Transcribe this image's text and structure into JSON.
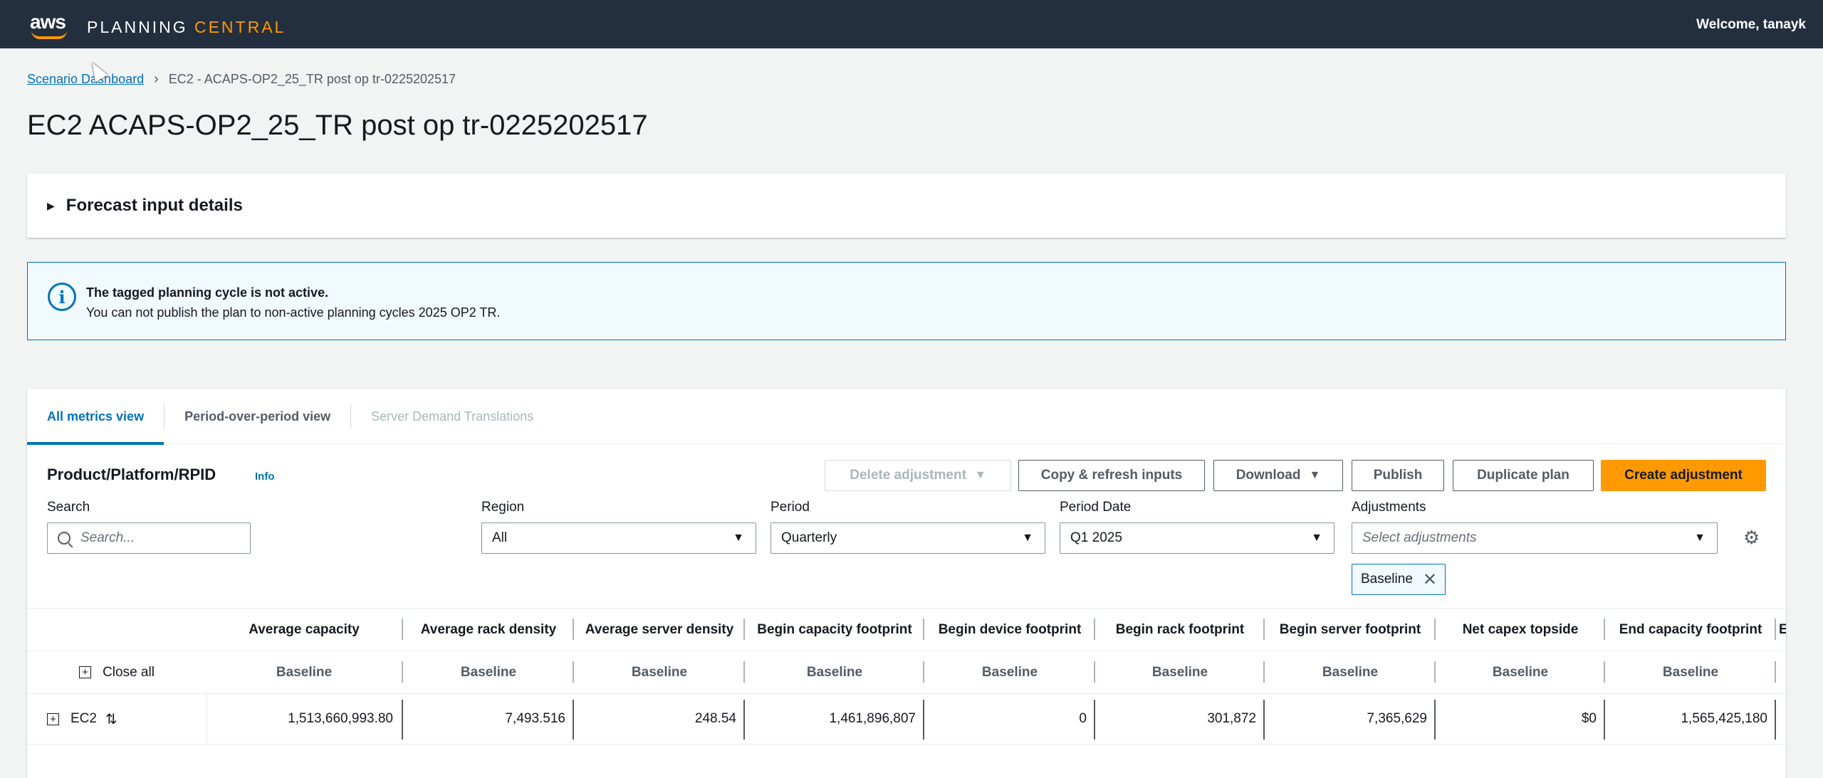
{
  "header": {
    "logo_text": "aws",
    "brand_a": "PLANNING ",
    "brand_b": "CENTRAL",
    "welcome": "Welcome, tanayk"
  },
  "breadcrumb": {
    "root": "Scenario Dashboard",
    "current": "EC2 - ACAPS-OP2_25_TR post op tr-0225202517"
  },
  "page": {
    "title": "EC2 ACAPS-OP2_25_TR post op tr-0225202517"
  },
  "forecast_panel": {
    "title": "Forecast input details"
  },
  "alert": {
    "title": "The tagged planning cycle is not active.",
    "message": "You can not publish the plan to non-active planning cycles 2025 OP2 TR."
  },
  "tabs": [
    {
      "label": "All metrics view",
      "state": "active"
    },
    {
      "label": "Period-over-period view",
      "state": "normal"
    },
    {
      "label": "Server Demand Translations",
      "state": "disabled"
    }
  ],
  "section": {
    "title": "Product/Platform/RPID",
    "info": "Info"
  },
  "actions": {
    "delete_adjustment": "Delete adjustment",
    "copy_refresh": "Copy & refresh inputs",
    "download": "Download",
    "publish": "Publish",
    "duplicate": "Duplicate plan",
    "create_adjustment": "Create adjustment"
  },
  "filters": {
    "search_label": "Search",
    "search_placeholder": "Search...",
    "region_label": "Region",
    "region_value": "All",
    "period_label": "Period",
    "period_value": "Quarterly",
    "period_date_label": "Period Date",
    "period_date_value": "Q1 2025",
    "adjustments_label": "Adjustments",
    "adjustments_placeholder": "Select adjustments",
    "token": "Baseline"
  },
  "table": {
    "columns": [
      "Average capacity",
      "Average rack density",
      "Average server density",
      "Begin capacity footprint",
      "Begin device footprint",
      "Begin rack footprint",
      "Begin server footprint",
      "Net capex topside",
      "End capacity footprint",
      "En"
    ],
    "subheader": "Baseline",
    "close_all": "Close all",
    "rows": [
      {
        "name": "EC2",
        "values": [
          "1,513,660,993.80",
          "7,493.516",
          "248.54",
          "1,461,896,807",
          "0",
          "301,872",
          "7,365,629",
          "$0",
          "1,565,425,180"
        ]
      }
    ]
  },
  "colors": {
    "topbar": "#232f3e",
    "accent_orange": "#ff9900",
    "link_blue": "#0073bb"
  }
}
